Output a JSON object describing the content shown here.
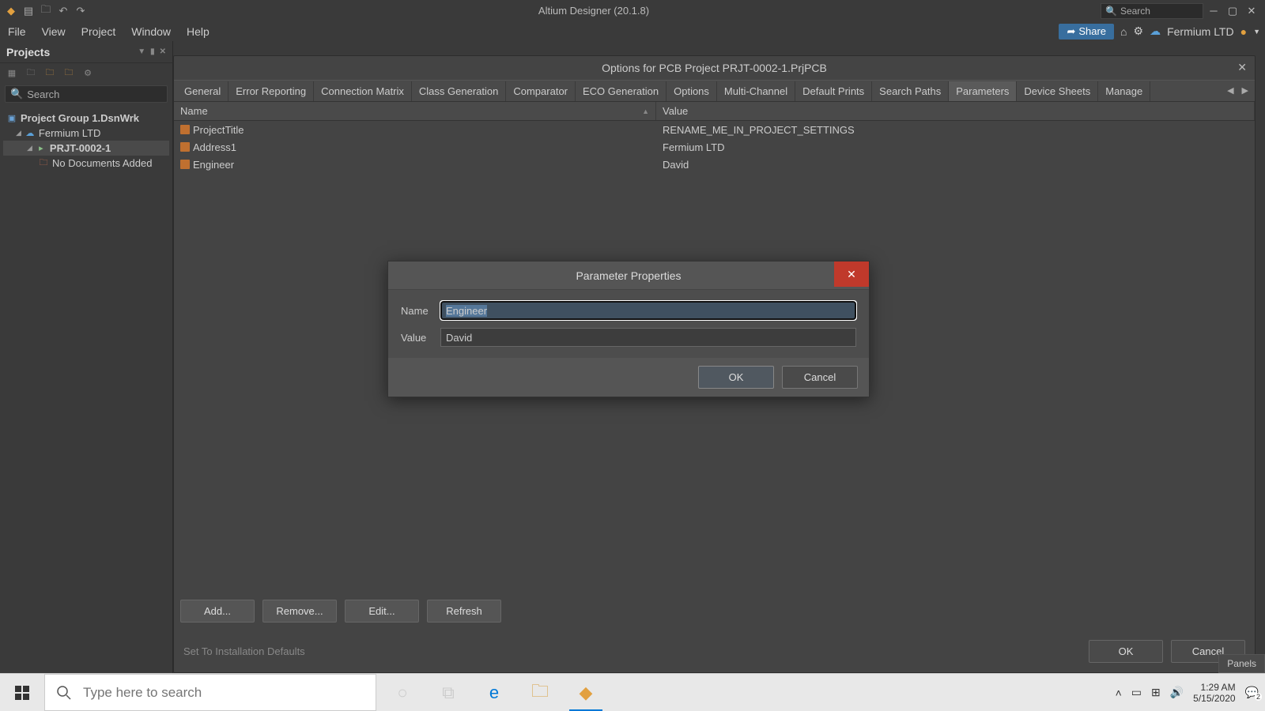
{
  "titlebar": {
    "app_title": "Altium Designer (20.1.8)",
    "search_placeholder": "Search"
  },
  "menubar": {
    "items": [
      "File",
      "View",
      "Project",
      "Window",
      "Help"
    ],
    "share": "Share",
    "org": "Fermium LTD"
  },
  "projects_panel": {
    "title": "Projects",
    "search_placeholder": "Search",
    "tree": {
      "group": "Project Group 1.DsnWrk",
      "org": "Fermium LTD",
      "project": "PRJT-0002-1",
      "empty": "No Documents Added"
    }
  },
  "options_doc": {
    "title": "Options for PCB Project PRJT-0002-1.PrjPCB",
    "tabs": [
      "General",
      "Error Reporting",
      "Connection Matrix",
      "Class Generation",
      "Comparator",
      "ECO Generation",
      "Options",
      "Multi-Channel",
      "Default Prints",
      "Search Paths",
      "Parameters",
      "Device Sheets",
      "Manage"
    ],
    "active_tab_index": 10,
    "columns": {
      "name": "Name",
      "value": "Value"
    },
    "rows": [
      {
        "name": "ProjectTitle",
        "value": "RENAME_ME_IN_PROJECT_SETTINGS"
      },
      {
        "name": "Address1",
        "value": "Fermium LTD"
      },
      {
        "name": "Engineer",
        "value": "David"
      }
    ],
    "buttons": {
      "add": "Add...",
      "remove": "Remove...",
      "edit": "Edit...",
      "refresh": "Refresh"
    },
    "defaults_link": "Set To Installation Defaults",
    "ok": "OK",
    "cancel": "Cancel"
  },
  "dialog": {
    "title": "Parameter Properties",
    "name_label": "Name",
    "value_label": "Value",
    "name_value": "Engineer",
    "value_value": "David",
    "ok": "OK",
    "cancel": "Cancel"
  },
  "panels_button": "Panels",
  "taskbar": {
    "search_placeholder": "Type here to search",
    "time": "1:29 AM",
    "date": "5/15/2020",
    "notif_count": "2"
  }
}
